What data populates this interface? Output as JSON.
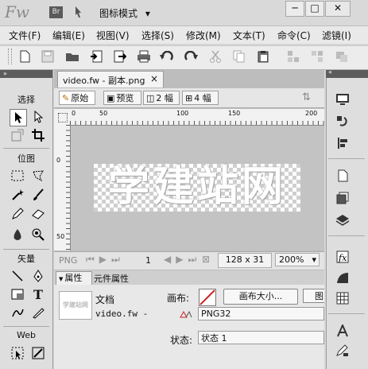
{
  "app": {
    "logo": "Fw",
    "bridge_badge": "Br",
    "mode_label": "图标模式"
  },
  "window_controls": {
    "minimize": "─",
    "maximize": "□",
    "close": "✕"
  },
  "menu": [
    "文件(F)",
    "编辑(E)",
    "视图(V)",
    "选择(S)",
    "修改(M)",
    "文本(T)",
    "命令(C)",
    "滤镜(I)"
  ],
  "tools_panel": {
    "sections": {
      "select": "选择",
      "bitmap": "位图",
      "vector": "矢量",
      "web": "Web"
    }
  },
  "document": {
    "tab_title": "video.fw - 副本.png",
    "tab_close": "×",
    "views": {
      "original": "原始",
      "preview": "预览",
      "two_up": "2 幅",
      "four_up": "4 幅"
    },
    "ruler": {
      "h_ticks": [
        "0",
        "50",
        "100",
        "150",
        "200"
      ],
      "v_ticks": [
        "0",
        "50"
      ]
    },
    "canvas_text": "学建站网"
  },
  "status_bar": {
    "format": "PNG",
    "frame": "1",
    "size": "128 x 31",
    "zoom": "200%"
  },
  "properties": {
    "tabs": [
      "属性",
      "元件属性"
    ],
    "thumb_text": "学建站网",
    "doc_label": "文档",
    "file_name": "video.fw -",
    "canvas_label": "画布:",
    "canvas_size_button": "画布大小...",
    "image_button": "图",
    "format_value": "PNG32",
    "state_label": "状态:",
    "state_value": "状态 1"
  },
  "colors": {
    "accent_red": "#cc2222",
    "panel": "#dedede"
  }
}
